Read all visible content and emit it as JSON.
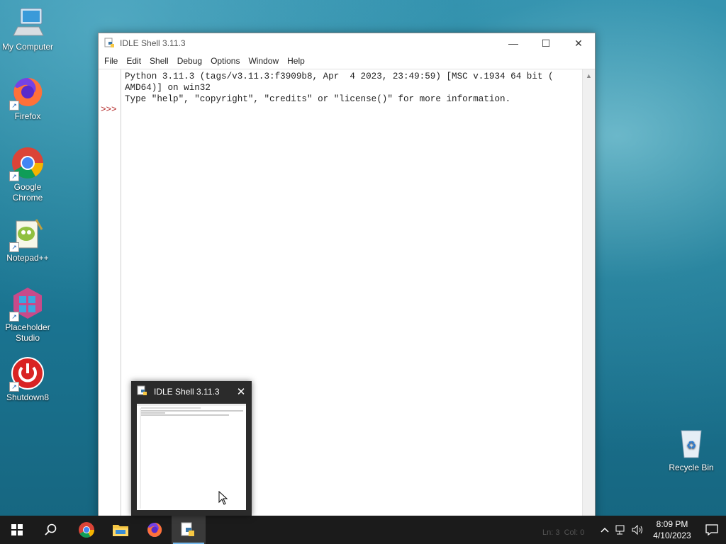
{
  "desktop": {
    "icons": [
      {
        "label": "My Computer",
        "icon": "computer-icon"
      },
      {
        "label": "Firefox",
        "icon": "firefox-icon"
      },
      {
        "label": "Google Chrome",
        "icon": "chrome-icon"
      },
      {
        "label": "Notepad++",
        "icon": "notepadpp-icon"
      },
      {
        "label": "Placeholder Studio",
        "icon": "placeholder-studio-icon"
      },
      {
        "label": "Shutdown8",
        "icon": "shutdown-icon"
      },
      {
        "label": "Recycle Bin",
        "icon": "recycle-bin-icon"
      }
    ]
  },
  "window": {
    "title": "IDLE Shell 3.11.3",
    "menu": [
      "File",
      "Edit",
      "Shell",
      "Debug",
      "Options",
      "Window",
      "Help"
    ],
    "prompt": ">>>",
    "lines": [
      "Python 3.11.3 (tags/v3.11.3:f3909b8, Apr  4 2023, 23:49:59) [MSC v.1934 64 bit (",
      "AMD64)] on win32",
      "Type \"help\", \"copyright\", \"credits\" or \"license()\" for more information."
    ],
    "status": {
      "line": "Ln: 3",
      "col": "Col: 0"
    }
  },
  "preview": {
    "title": "IDLE Shell 3.11.3"
  },
  "taskbar": {
    "items": [
      "start-button",
      "search-button",
      "chrome",
      "file-explorer",
      "firefox",
      "idle-python"
    ],
    "active": "idle-python",
    "time": "8:09 PM",
    "date": "4/10/2023"
  },
  "colors": {
    "taskbar": "#1b1b1b",
    "prompt": "#b02020",
    "accent": "#76b9ed"
  }
}
